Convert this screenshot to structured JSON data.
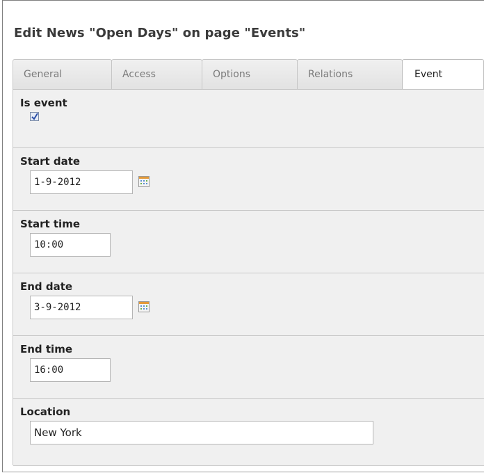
{
  "page_title": "Edit News \"Open Days\" on page \"Events\"",
  "tabs": [
    {
      "label": "General"
    },
    {
      "label": "Access"
    },
    {
      "label": "Options"
    },
    {
      "label": "Relations"
    },
    {
      "label": "Event"
    }
  ],
  "active_tab": "Event",
  "fields": {
    "is_event": {
      "label": "Is event",
      "checked": true
    },
    "start_date": {
      "label": "Start date",
      "value": "1-9-2012"
    },
    "start_time": {
      "label": "Start time",
      "value": "10:00"
    },
    "end_date": {
      "label": "End date",
      "value": "3-9-2012"
    },
    "end_time": {
      "label": "End time",
      "value": "16:00"
    },
    "location": {
      "label": "Location",
      "value": "New York"
    }
  },
  "icons": {
    "calendar": "calendar-icon",
    "check": "checkmark-icon"
  }
}
